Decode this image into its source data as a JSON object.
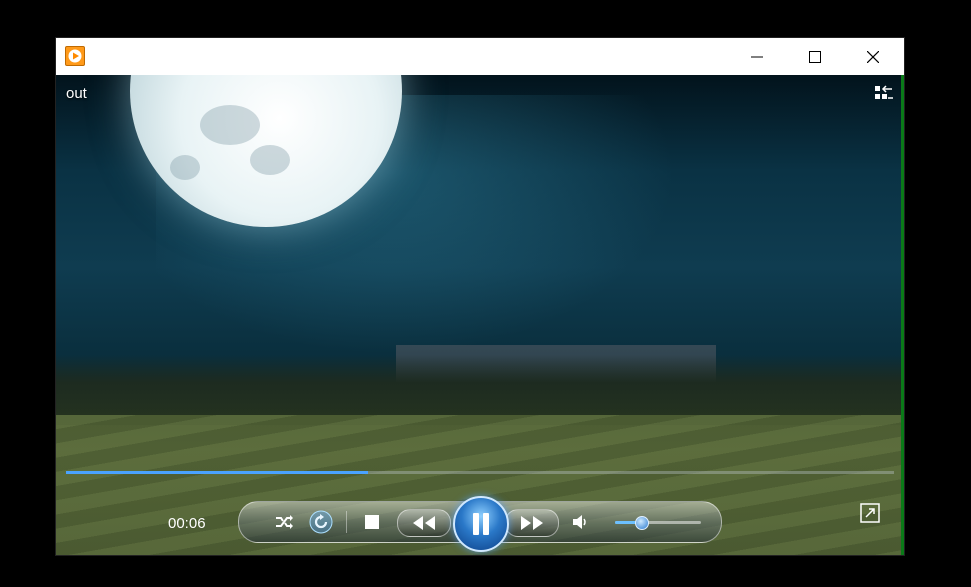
{
  "window": {
    "title": ""
  },
  "titlebar": {
    "minimize_icon": "minimize-icon",
    "maximize_icon": "maximize-icon",
    "close_icon": "close-icon"
  },
  "overlay": {
    "media_title": "out",
    "switch_view_icon": "switch-to-library-icon"
  },
  "playback": {
    "elapsed": "00:06",
    "progress_fraction": 0.365,
    "volume_fraction": 0.3
  },
  "controls": {
    "shuffle_icon": "shuffle-icon",
    "repeat_icon": "repeat-icon",
    "stop_icon": "stop-icon",
    "previous_icon": "previous-icon",
    "pause_icon": "pause-icon",
    "next_icon": "next-icon",
    "mute_icon": "volume-icon",
    "fullscreen_icon": "fullscreen-icon"
  },
  "colors": {
    "accent": "#4aa3ff",
    "titlebar_bg": "#ffffff",
    "app_icon": "#ff9a1a",
    "right_edge": "#0a7a18"
  }
}
